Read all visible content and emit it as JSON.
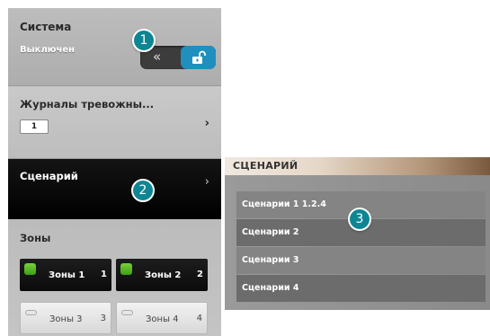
{
  "system": {
    "title": "Система",
    "status": "Выключен",
    "back_glyph": "«",
    "lock_icon": "unlock-icon"
  },
  "journal": {
    "title": "Журналы тревожны...",
    "badge": "1",
    "chevron": "›"
  },
  "scenario": {
    "title": "Сценарий",
    "chevron": "›"
  },
  "zones": {
    "title": "Зоны",
    "items": [
      {
        "label": "Зоны 1",
        "num": "1",
        "active": true
      },
      {
        "label": "Зоны 2",
        "num": "2",
        "active": true
      },
      {
        "label": "Зоны 3",
        "num": "3",
        "active": false
      },
      {
        "label": "Зоны 4",
        "num": "4",
        "active": false
      }
    ]
  },
  "scenario_panel": {
    "header": "СЦЕНАРИЙ",
    "items": [
      {
        "label": "Сценарии 1 1.2.4"
      },
      {
        "label": "Сценарии 2"
      },
      {
        "label": "Сценарии 3"
      },
      {
        "label": "Сценарии 4"
      }
    ]
  },
  "callouts": [
    "1",
    "2",
    "3"
  ],
  "colors": {
    "accent_blue": "#1f90bd",
    "callout_teal": "#0e8593",
    "zone_active_led": "#5cb82a"
  }
}
